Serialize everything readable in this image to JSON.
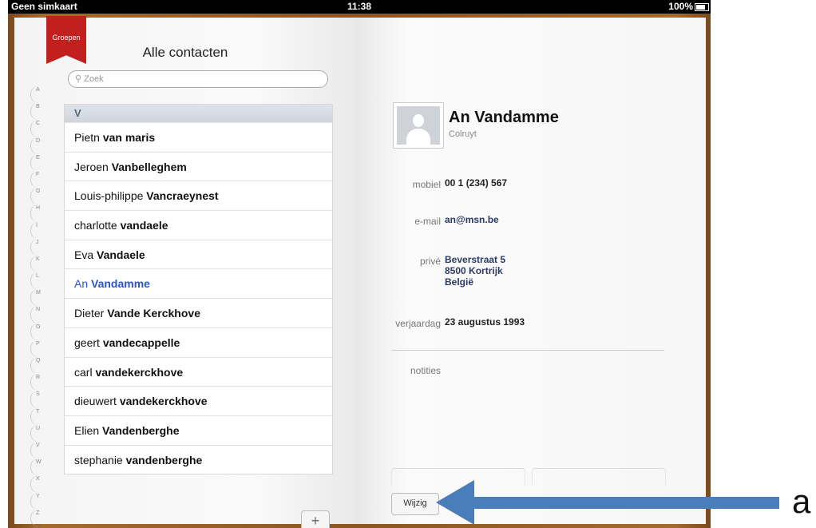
{
  "statusbar": {
    "carrier": "Geen simkaart",
    "time": "11:38",
    "battery": "100%"
  },
  "left": {
    "ribbon": "Groepen",
    "title": "Alle contacten",
    "search_placeholder": "Zoek",
    "alpha": [
      "A",
      "B",
      "C",
      "D",
      "E",
      "F",
      "G",
      "H",
      "I",
      "J",
      "K",
      "L",
      "M",
      "N",
      "O",
      "P",
      "Q",
      "R",
      "S",
      "T",
      "U",
      "V",
      "W",
      "X",
      "Y",
      "Z",
      "#"
    ],
    "section": "V",
    "contacts": [
      {
        "first": "Pietn",
        "last": "van maris"
      },
      {
        "first": "Jeroen",
        "last": "Vanbelleghem"
      },
      {
        "first": "Louis-philippe",
        "last": "Vancraeynest"
      },
      {
        "first": "charlotte",
        "last": "vandaele"
      },
      {
        "first": "Eva",
        "last": "Vandaele"
      },
      {
        "first": "An",
        "last": "Vandamme"
      },
      {
        "first": "Dieter",
        "last": "Vande Kerckhove"
      },
      {
        "first": "geert",
        "last": "vandecappelle"
      },
      {
        "first": "carl",
        "last": "vandekerckhove"
      },
      {
        "first": "dieuwert",
        "last": "vandekerckhove"
      },
      {
        "first": "Elien",
        "last": "Vandenberghe"
      },
      {
        "first": "stephanie",
        "last": "vandenberghe"
      }
    ],
    "selected_index": 5,
    "add_label": "+"
  },
  "right": {
    "name": "An Vandamme",
    "company": "Colruyt",
    "mobile_label": "mobiel",
    "mobile": "00 1 (234) 567",
    "email_label": "e-mail",
    "email": "an@msn.be",
    "home_label": "privé",
    "address": [
      "Beverstraat 5",
      "8500 Kortrijk",
      "België"
    ],
    "birthday_label": "verjaardag",
    "birthday": "23 augustus 1993",
    "notes_label": "notities",
    "edit_label": "Wijzig"
  },
  "annotation": {
    "label": "a",
    "color": "#4a7ebb"
  }
}
